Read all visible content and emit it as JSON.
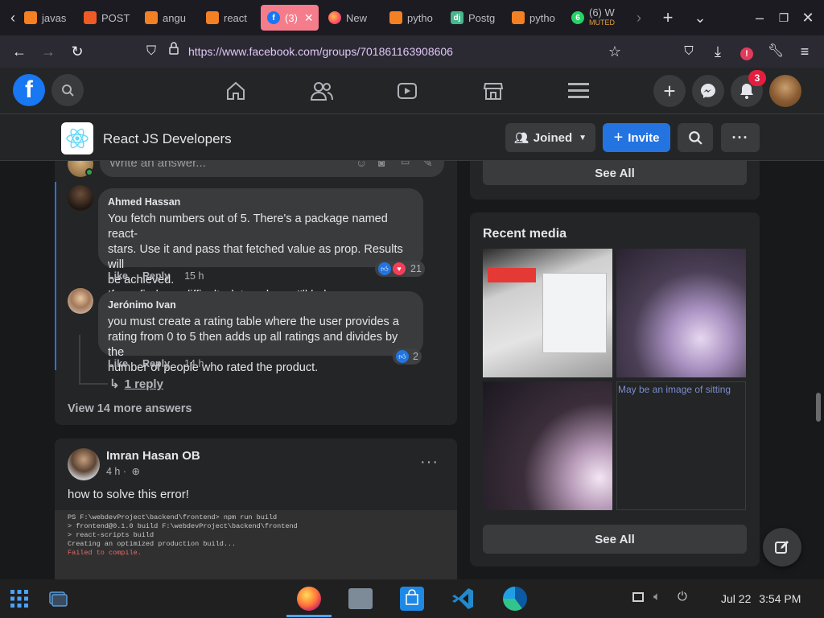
{
  "browser": {
    "tabs": [
      {
        "label": "javas",
        "icon": "stackoverflow-icon"
      },
      {
        "label": "POST",
        "icon": "postman-icon"
      },
      {
        "label": "angu",
        "icon": "stackoverflow-icon"
      },
      {
        "label": "react",
        "icon": "stackoverflow-icon"
      },
      {
        "label": "(3)",
        "icon": "facebook-icon",
        "active": true
      },
      {
        "label": "New",
        "icon": "firefox-icon"
      },
      {
        "label": "pytho",
        "icon": "stackoverflow-icon"
      },
      {
        "label": "Postg",
        "icon": "django-icon"
      },
      {
        "label": "pytho",
        "icon": "stackoverflow-icon"
      },
      {
        "label": "(6) W",
        "sub": "MUTED",
        "icon": "whatsapp-icon"
      }
    ],
    "url": "https://www.facebook.com/groups/701861163908606",
    "notif_badge": "3"
  },
  "group": {
    "name": "React JS Developers",
    "joined_label": "Joined",
    "invite_label": "Invite"
  },
  "comments": {
    "write_placeholder": "Write an answer...",
    "items": [
      {
        "author": "Ahmed Hassan",
        "text1": "You fetch numbers out of 5. There's a package named react-",
        "text2": "stars. Use it and pass that fetched value as prop. Results will",
        "text3": "be achieved.",
        "text4": "If you find any difficulty, let me know I'll help",
        "reactions": "21",
        "like": "Like",
        "reply": "Reply",
        "time": "15 h"
      },
      {
        "author": "Jerónimo Ivan",
        "text1": "you must create a rating table where the user provides a",
        "text2": "rating from 0 to 5 then adds up all ratings and divides by the",
        "text3": "number of people who rated the product.",
        "reactions": "2",
        "like": "Like",
        "reply": "Reply",
        "time": "14 h"
      }
    ],
    "reply_link": "1 reply",
    "view_more": "View 14 more answers"
  },
  "post": {
    "author": "Imran Hasan OB",
    "time": "4 h ·",
    "text": "how to solve this error!",
    "terminal": [
      "PS F:\\webdevProject\\backend\\frontend> npm run build",
      "",
      "> frontend@0.1.0 build F:\\webdevProject\\backend\\frontend",
      "> react-scripts build",
      "",
      "Creating an optimized production build...",
      "Failed to compile."
    ]
  },
  "sidebar": {
    "see_all_top": "See All",
    "recent_media_title": "Recent media",
    "image_alt": "May be an image of sitting",
    "see_all_bottom": "See All"
  },
  "taskbar": {
    "date": "Jul 22",
    "time": "3:54 PM"
  },
  "colors": {
    "fb_blue": "#2374e1",
    "active_tab": "#f57c8b",
    "fb_bg": "#18191a",
    "card_bg": "#242526"
  }
}
